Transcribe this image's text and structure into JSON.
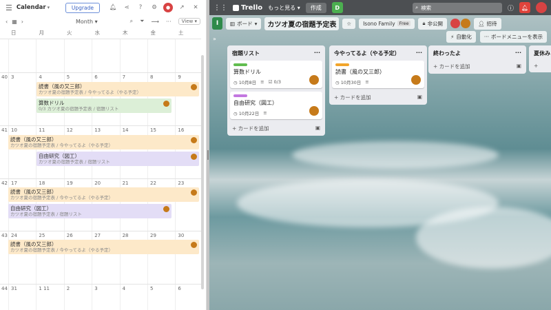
{
  "calendar": {
    "title": "Calendar",
    "upgrade_label": "Upgrade",
    "view_mode": "Month",
    "view_label": "View",
    "weekdays": [
      "日",
      "月",
      "火",
      "水",
      "木",
      "金",
      "土"
    ],
    "weeks": [
      {
        "num": "",
        "days": [
          "",
          "",
          "",
          "",
          "",
          "",
          ""
        ]
      },
      {
        "num": "40",
        "days": [
          "3",
          "4",
          "5",
          "6",
          "7",
          "8",
          "9"
        ]
      },
      {
        "num": "41",
        "days": [
          "10",
          "11",
          "12",
          "13",
          "14",
          "15",
          "16"
        ]
      },
      {
        "num": "42",
        "days": [
          "17",
          "18",
          "19",
          "20",
          "21",
          "22",
          "23"
        ]
      },
      {
        "num": "43",
        "days": [
          "24",
          "25",
          "26",
          "27",
          "28",
          "29",
          "30"
        ]
      },
      {
        "num": "44",
        "days": [
          "31",
          "1 11",
          "2",
          "3",
          "4",
          "5",
          "6"
        ]
      }
    ],
    "events": [
      {
        "title": "読書（風の又三郎）",
        "sub": "カツオ夏の宿題予定表 / 今やってるよ（やる予定）"
      },
      {
        "title": "算数ドリル",
        "sub": "0/3 カツオ夏の宿題予定表 / 宿題リスト"
      },
      {
        "title": "読書（風の又三郎）",
        "sub": "カツオ夏の宿題予定表 / 今やってるよ（やる予定）"
      },
      {
        "title": "自由研究（図工）",
        "sub": "カツオ夏の宿題予定表 / 宿題リスト"
      },
      {
        "title": "読書（風の又三郎）",
        "sub": "カツオ夏の宿題予定表 / 今やってるよ（やる予定）"
      },
      {
        "title": "自由研究（図工）",
        "sub": "カツオ夏の宿題予定表 / 宿題リスト"
      },
      {
        "title": "読書（風の又三郎）",
        "sub": "カツオ夏の宿題予定表 / 今やってるよ（やる予定）"
      }
    ]
  },
  "trello": {
    "brand": "Trello",
    "more": "もっと見る",
    "create": "作成",
    "search_placeholder": "検索",
    "board_label": "ボード",
    "board_title": "カツオ夏の宿題予定表",
    "workspace": "Isono Family",
    "free_badge": "Free",
    "visibility": "非公開",
    "invite": "招待",
    "automation": "自動化",
    "board_menu": "ボードメニューを表示",
    "add_card": "カードを追加",
    "lists": [
      {
        "title": "宿題リスト",
        "cards": [
          {
            "label_color": "#61bd4f",
            "title": "算数ドリル",
            "date": "10月8日",
            "checklist": "0/3"
          },
          {
            "label_color": "#c377e0",
            "title": "自由研究（図工）",
            "date": "10月22日",
            "checklist": ""
          }
        ]
      },
      {
        "title": "今やってるよ（やる予定）",
        "cards": [
          {
            "label_color": "#f2a52b",
            "title": "読書（風の又三郎）",
            "date": "10月30日",
            "checklist": ""
          }
        ]
      },
      {
        "title": "終わったよ",
        "cards": []
      },
      {
        "title": "夏休み",
        "cards": []
      }
    ]
  }
}
